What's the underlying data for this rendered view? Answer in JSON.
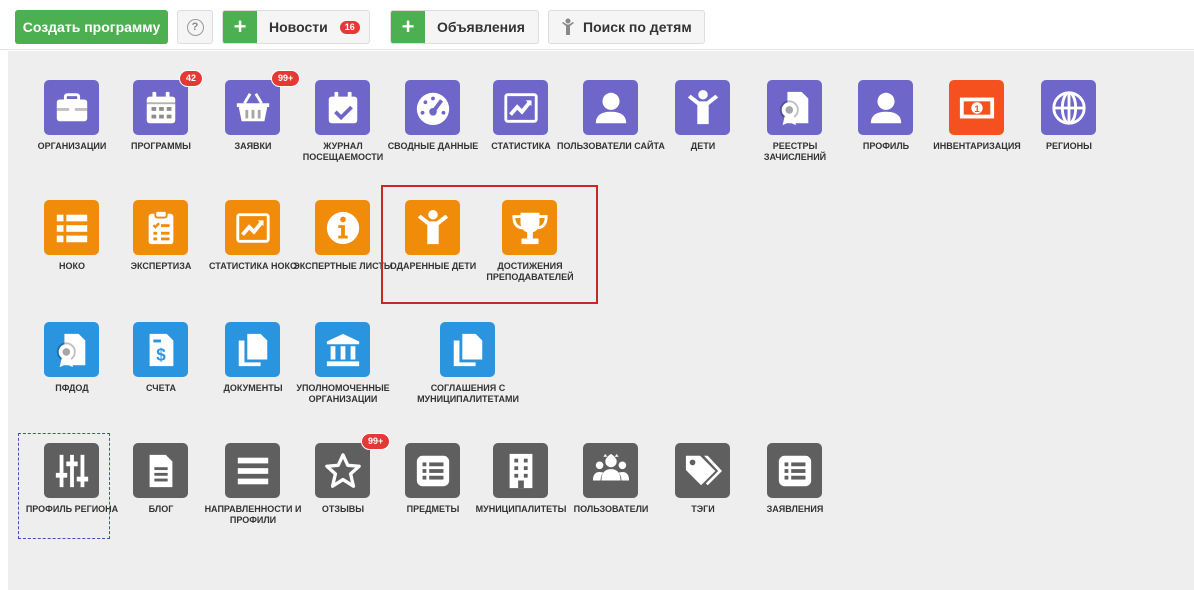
{
  "header": {
    "create_label": "Создать программу",
    "help_label": "?",
    "news_label": "Новости",
    "news_badge": "16",
    "ads_label": "Объявления",
    "children_search_label": "Поиск по детям"
  },
  "colors": {
    "purple": "#6e67c9",
    "orange": "#f08c0a",
    "blue": "#2b94df",
    "gray": "#5f5f5f",
    "green": "#4caf50",
    "badge": "#e53935"
  },
  "row1": [
    {
      "label": "ОРГАНИЗАЦИИ",
      "icon": "briefcase-icon"
    },
    {
      "label": "ПРОГРАММЫ",
      "icon": "calendar-icon",
      "badge": "42"
    },
    {
      "label": "ЗАЯВКИ",
      "icon": "basket-icon",
      "badge": "99+"
    },
    {
      "label": "ЖУРНАЛ ПОСЕЩАЕМОСТИ",
      "icon": "calendar-check-icon"
    },
    {
      "label": "СВОДНЫЕ ДАННЫЕ",
      "icon": "gauge-icon"
    },
    {
      "label": "СТАТИСТИКА",
      "icon": "chart-icon"
    },
    {
      "label": "ПОЛЬЗОВАТЕЛИ САЙТА",
      "icon": "user-icon"
    },
    {
      "label": "ДЕТИ",
      "icon": "child-icon"
    },
    {
      "label": "РЕЕСТРЫ ЗАЧИСЛЕНИЙ",
      "icon": "certificate-icon"
    },
    {
      "label": "ПРОФИЛЬ",
      "icon": "user-icon"
    },
    {
      "label": "ИНВЕНТАРИЗАЦИЯ",
      "icon": "money-icon"
    },
    {
      "label": "РЕГИОНЫ",
      "icon": "globe-icon"
    }
  ],
  "row2": [
    {
      "label": "НОКО",
      "icon": "list-icon"
    },
    {
      "label": "ЭКСПЕРТИЗА",
      "icon": "clipboard-icon"
    },
    {
      "label": "СТАТИСТИКА НОКО",
      "icon": "chart-icon"
    },
    {
      "label": "ЭКСПЕРТНЫЕ ЛИСТЫ",
      "icon": "info-icon"
    },
    {
      "label": "ОДАРЕННЫЕ ДЕТИ",
      "icon": "child-icon"
    },
    {
      "label": "ДОСТИЖЕНИЯ ПРЕПОДАВАТЕЛЕЙ",
      "icon": "trophy-icon"
    }
  ],
  "row3": [
    {
      "label": "ПФДОД",
      "icon": "certificate-icon"
    },
    {
      "label": "СЧЕТА",
      "icon": "invoice-icon"
    },
    {
      "label": "ДОКУМЕНТЫ",
      "icon": "documents-icon"
    },
    {
      "label": "УПОЛНОМОЧЕННЫЕ ОРГАНИЗАЦИИ",
      "icon": "bank-icon"
    },
    {
      "label": "СОГЛАШЕНИЯ С МУНИЦИПАЛИТЕТАМИ",
      "icon": "documents-icon"
    }
  ],
  "row4": [
    {
      "label": "ПРОФИЛЬ РЕГИОНА",
      "icon": "sliders-icon"
    },
    {
      "label": "БЛОГ",
      "icon": "file-icon"
    },
    {
      "label": "НАПРАВЛЕННОСТИ И ПРОФИЛИ",
      "icon": "bars-icon"
    },
    {
      "label": "ОТЗЫВЫ",
      "icon": "star-icon",
      "badge": "99+"
    },
    {
      "label": "ПРЕДМЕТЫ",
      "icon": "list-box-icon"
    },
    {
      "label": "МУНИЦИПАЛИТЕТЫ",
      "icon": "building-icon"
    },
    {
      "label": "ПОЛЬЗОВАТЕЛИ",
      "icon": "users-icon"
    },
    {
      "label": "ТЭГИ",
      "icon": "tags-icon"
    },
    {
      "label": "ЗАЯВЛЕНИЯ",
      "icon": "list-box-icon"
    }
  ]
}
